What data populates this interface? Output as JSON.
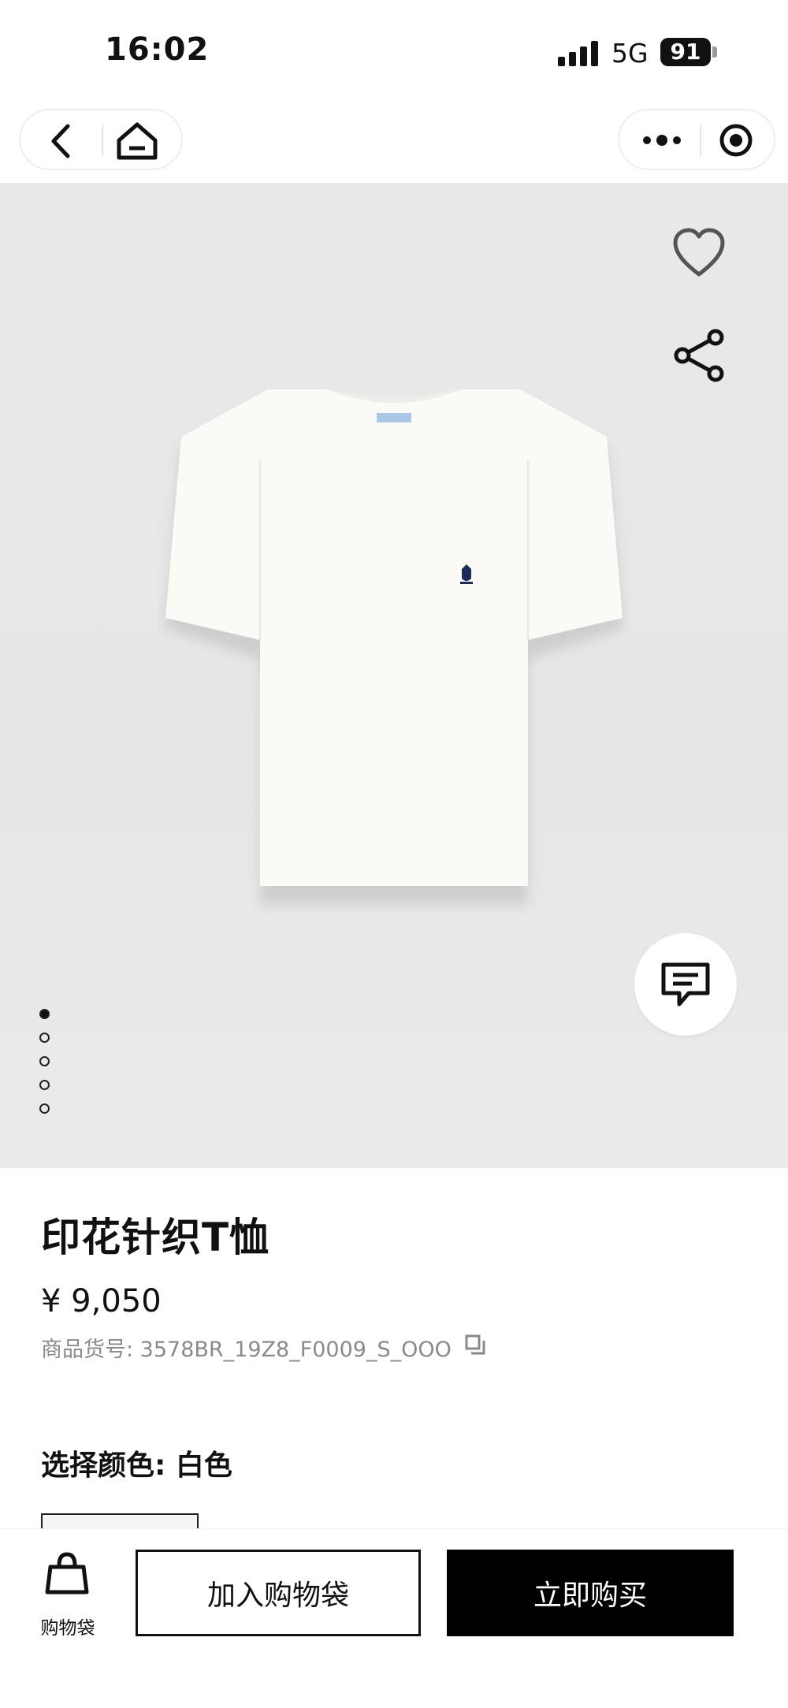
{
  "status": {
    "time": "16:02",
    "network": "5G",
    "battery": "91"
  },
  "nav": {
    "back_icon": "chevron-left-icon",
    "home_icon": "home-icon",
    "more_icon": "more-dots-icon",
    "record_icon": "target-icon"
  },
  "gallery": {
    "image_alt": "white short-sleeve t-shirt",
    "favorite_icon": "heart-icon",
    "share_icon": "share-icon",
    "chat_icon": "chat-icon",
    "slide_count": 5,
    "active_slide": 1
  },
  "product": {
    "title": "印花针织T恤",
    "price": "¥ 9,050",
    "sku": "商品货号: 3578BR_19Z8_F0009_S_OOO",
    "color_label": "选择颜色: 白色"
  },
  "bottom": {
    "bag_label": "购物袋",
    "add_to_bag": "加入购物袋",
    "buy_now": "立即购买"
  },
  "colors": {
    "accent": "#000000",
    "background": "#e8e8e9",
    "muted": "#8a8a8a"
  }
}
